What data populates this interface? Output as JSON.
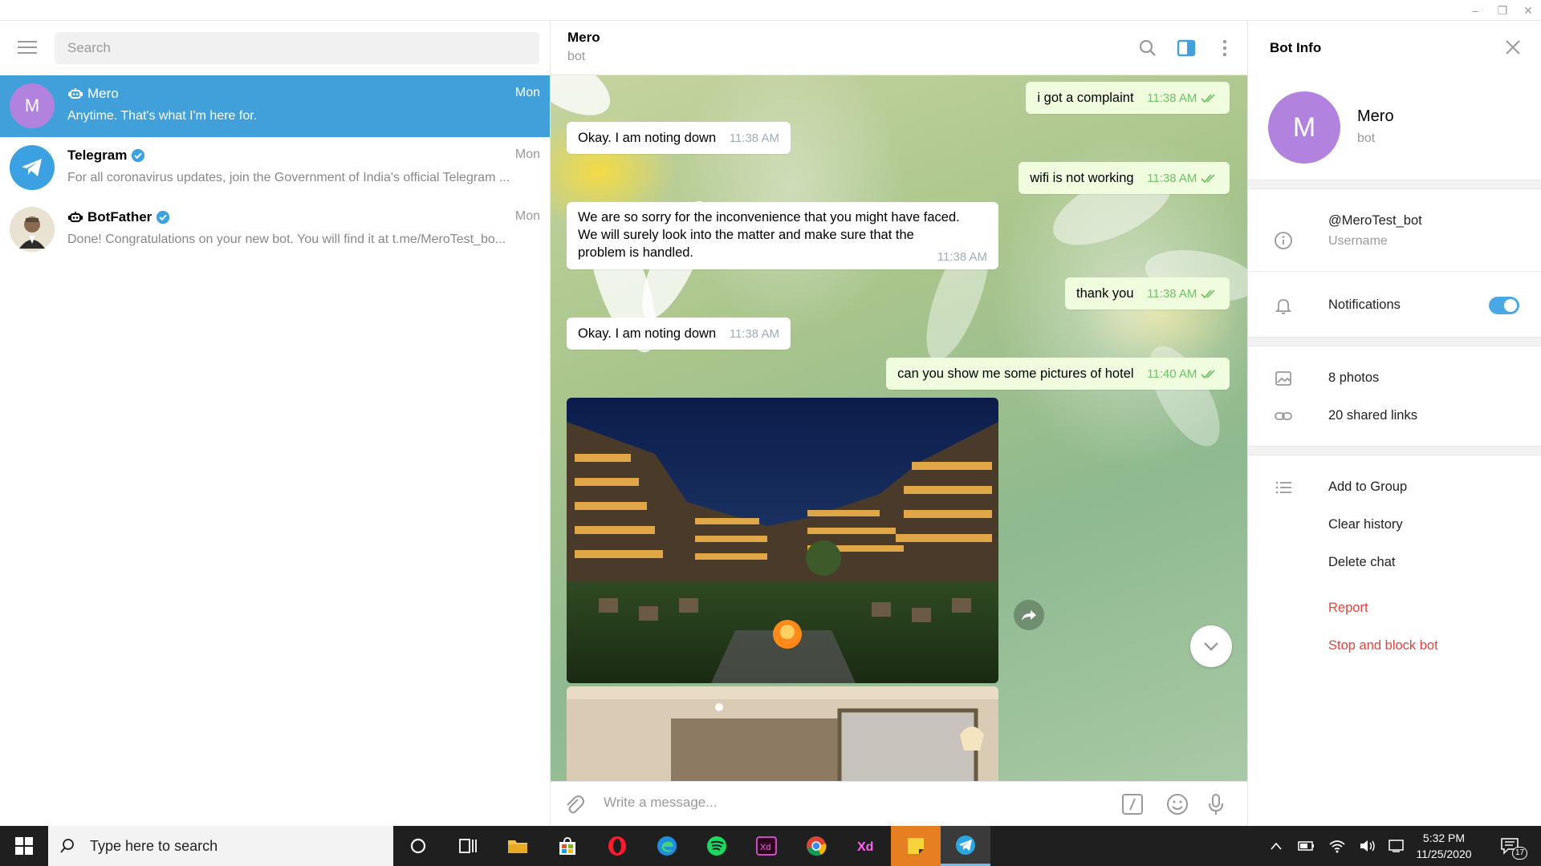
{
  "window": {
    "controls": [
      "minimize",
      "restore",
      "close"
    ]
  },
  "left": {
    "search_placeholder": "Search",
    "dialogs": [
      {
        "name": "Mero",
        "time": "Mon",
        "message": "Anytime. That's what I'm here for.",
        "avatar_letter": "M",
        "avatar_color": "#b183de",
        "bot": true,
        "verified": false,
        "active": true
      },
      {
        "name": "Telegram",
        "time": "Mon",
        "message": "For all coronavirus updates, join the Government of India's official Telegram ...",
        "avatar_color": "#3ba1e0",
        "bot": false,
        "verified": true,
        "active": false
      },
      {
        "name": "BotFather",
        "time": "Mon",
        "message": "Done! Congratulations on your new bot. You will find it at t.me/MeroTest_bo...",
        "avatar_color": "#5b7a93",
        "bot": true,
        "verified": true,
        "active": false
      }
    ]
  },
  "chat": {
    "name": "Mero",
    "status": "bot",
    "messages": [
      {
        "dir": "out",
        "text": "i got a complaint",
        "time": "11:38 AM"
      },
      {
        "dir": "in",
        "text": "Okay. I am noting down",
        "time": "11:38 AM"
      },
      {
        "dir": "out",
        "text": "wifi is not working",
        "time": "11:38 AM"
      },
      {
        "dir": "in",
        "lines": [
          "We are so sorry for the inconvenience that you might have faced.",
          "We will surely look into the matter and make sure that the",
          "problem is handled."
        ],
        "time": "11:38 AM"
      },
      {
        "dir": "out",
        "text": "thank you",
        "time": "11:38 AM"
      },
      {
        "dir": "in",
        "text": "Okay. I am noting down",
        "time": "11:38 AM"
      },
      {
        "dir": "out",
        "text": "can you show me some pictures of hotel",
        "time": "11:40 AM"
      }
    ],
    "composer_placeholder": "Write a message..."
  },
  "info": {
    "title": "Bot Info",
    "name": "Mero",
    "subtitle": "bot",
    "avatar_letter": "M",
    "avatar_color": "#b183de",
    "username": "@MeroTest_bot",
    "username_label": "Username",
    "notifications_label": "Notifications",
    "notifications_on": true,
    "photos": "8 photos",
    "links": "20 shared links",
    "add_to_group": "Add to Group",
    "clear_history": "Clear history",
    "delete_chat": "Delete chat",
    "report": "Report",
    "stop_block": "Stop and block bot",
    "accent_color": "#4aa8e6",
    "danger_color": "#e4443b"
  },
  "taskbar": {
    "search_placeholder": "Type here to search",
    "time": "5:32 PM",
    "date": "11/25/2020",
    "notification_count": "17",
    "apps": [
      "cortana",
      "task-view",
      "file-explorer",
      "store",
      "opera",
      "edge",
      "spotify",
      "xd-dark",
      "chrome",
      "xd",
      "sticky-notes",
      "telegram"
    ]
  }
}
